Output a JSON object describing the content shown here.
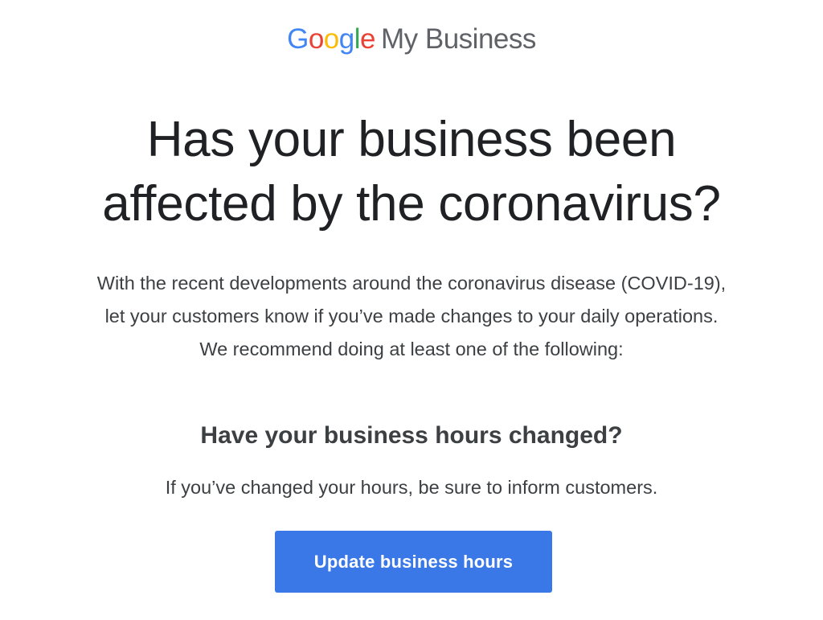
{
  "logo": {
    "google_letters": [
      {
        "char": "G",
        "color": "#4285F4"
      },
      {
        "char": "o",
        "color": "#EA4335"
      },
      {
        "char": "o",
        "color": "#FBBC05"
      },
      {
        "char": "g",
        "color": "#4285F4"
      },
      {
        "char": "l",
        "color": "#34A853"
      },
      {
        "char": "e",
        "color": "#EA4335"
      }
    ],
    "product_name": "My Business"
  },
  "headline": {
    "line1": "Has your business been",
    "line2": "affected by the coronavirus?"
  },
  "intro": {
    "line1": "With the recent developments around the coronavirus disease (COVID-19),",
    "line2": "let your customers know if you’ve made changes to your daily operations.",
    "line3": "We recommend doing at least one of the following:"
  },
  "hours_section": {
    "title": "Have your business hours changed?",
    "description": "If you’ve changed your hours, be sure to inform customers.",
    "button_label": "Update business hours"
  },
  "colors": {
    "button_blue": "#3b78e7",
    "text_dark": "#202124",
    "text_gray": "#5f6368"
  }
}
